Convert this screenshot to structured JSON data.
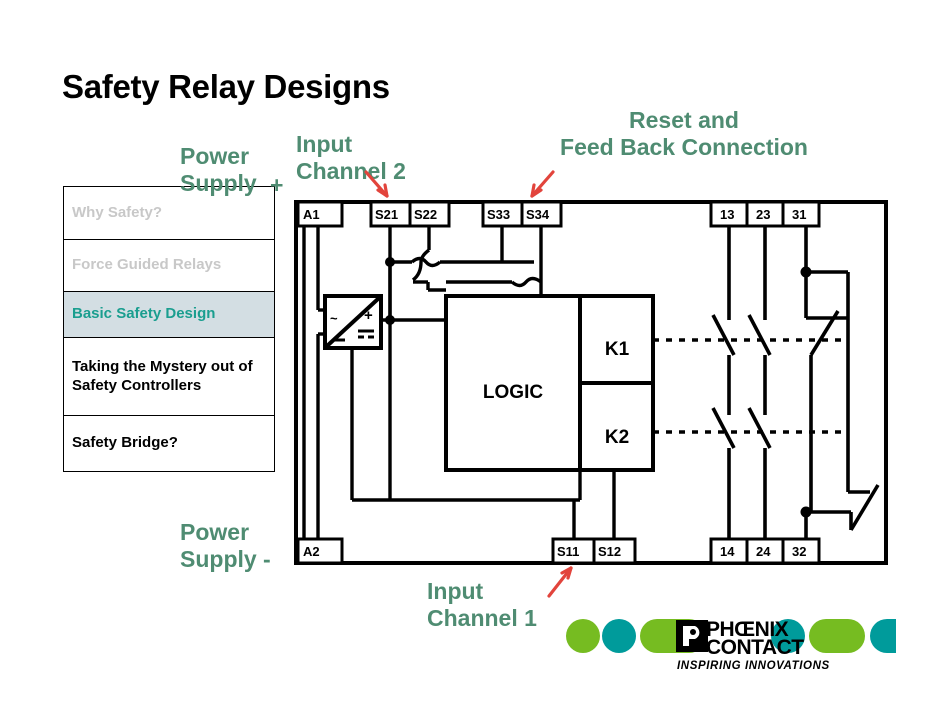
{
  "slide": {
    "title": "Safety Relay Designs"
  },
  "sidebar": {
    "items": [
      {
        "label": "Why Safety?",
        "state": "dim",
        "size": "h1"
      },
      {
        "label": "Force Guided Relays",
        "state": "dim",
        "size": "h2"
      },
      {
        "label": "Basic Safety Design",
        "state": "active",
        "size": "h3"
      },
      {
        "label": "Taking the Mystery out of Safety Controllers",
        "state": "dark",
        "size": "h4"
      },
      {
        "label": "Safety Bridge?",
        "state": "dark",
        "size": "h5"
      }
    ]
  },
  "annotations": {
    "power_supply_plus": "Power\nSupply",
    "plus_sign": "+",
    "input_channel_2": "Input\nChannel 2",
    "reset_feedback": "Reset and\nFeed Back Connection",
    "power_supply_minus": "Power\nSupply -",
    "input_channel_1": "Input\nChannel 1",
    "arrow_color": "#e2443c",
    "text_color": "#4f8c72"
  },
  "schematic": {
    "logic_label": "LOGIC",
    "relay_k1": "K1",
    "relay_k2": "K2",
    "converter": {
      "ac_symbol": "~",
      "plus_symbol": "+",
      "dc_symbol": "=",
      "minus_symbol": "_"
    },
    "terminals_top": [
      "A1",
      "S21",
      "S22",
      "S33",
      "S34"
    ],
    "terminals_top_right": [
      "13",
      "23",
      "31"
    ],
    "terminals_bottom": [
      "A2",
      "S11",
      "S12"
    ],
    "terminals_bottom_right": [
      "14",
      "24",
      "32"
    ]
  },
  "logo": {
    "brand_line1": "PHŒNIX",
    "brand_line2": "CONTACT",
    "tagline": "INSPIRING INNOVATIONS",
    "green": "#76bc21",
    "teal": "#009b9b"
  }
}
